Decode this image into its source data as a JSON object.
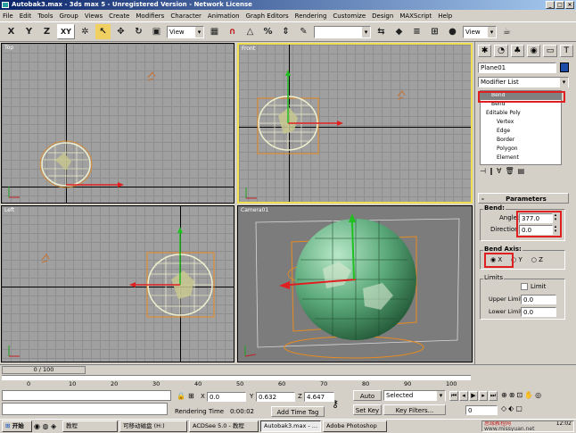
{
  "window": {
    "title": "Autobak3.max - 3ds max 5 - Unregistered Version - Network License"
  },
  "menu": [
    "File",
    "Edit",
    "Tools",
    "Group",
    "Views",
    "Create",
    "Modifiers",
    "Character",
    "Animation",
    "Graph Editors",
    "Rendering",
    "Customize",
    "Design",
    "MAXScript",
    "Help"
  ],
  "toolbar": {
    "axis_x": "X",
    "axis_y": "Y",
    "axis_z": "Z",
    "axis_xy": "XY",
    "view_left": "View",
    "view_right": "View"
  },
  "viewports": {
    "top": "Top",
    "front": "Front",
    "left": "Left",
    "camera": "Camera01"
  },
  "command_panel": {
    "object_name": "Plane01",
    "modifier_list": "Modifier List",
    "stack": [
      "Bend",
      "Bend",
      "Editable Poly",
      "Vertex",
      "Edge",
      "Border",
      "Polygon",
      "Element"
    ],
    "rollout_title": "Parameters",
    "bend_group": "Bend:",
    "angle_label": "Angle:",
    "angle_value": "377.0",
    "direction_label": "Direction:",
    "direction_value": "0.0",
    "bend_axis_group": "Bend Axis:",
    "axis_options": [
      "X",
      "Y",
      "Z"
    ],
    "limits_group": "Limits",
    "limit_checkbox": "Limit",
    "upper_limit_label": "Upper Limit:",
    "upper_limit_value": "0.0",
    "lower_limit_label": "Lower Limit:",
    "lower_limit_value": "0.0"
  },
  "timeline": {
    "frame_display": "0 / 100",
    "ticks": [
      "0",
      "10",
      "20",
      "30",
      "40",
      "50",
      "60",
      "70",
      "80",
      "90",
      "100"
    ]
  },
  "status": {
    "x_label": "X",
    "x_value": "0.0",
    "y_label": "Y",
    "y_value": "0.632",
    "z_label": "Z",
    "z_value": "4.647",
    "rendering_time_label": "Rendering Time",
    "rendering_time_value": "0:00:02",
    "add_time_tag": "Add Time Tag",
    "auto_key": "Auto Key",
    "set_key": "Set Key",
    "selected": "Selected",
    "key_filters": "Key Filters...",
    "frame_field": "0"
  },
  "taskbar": {
    "start": "开始",
    "items": [
      "教程",
      "可移动磁盘 (H:)",
      "ACDSee 5.0 - 教程",
      "Autobak3.max - ...",
      "Adobe Photoshop"
    ],
    "watermark": "思缘教程网",
    "watermark_url": "www.missyuan.net",
    "clock": "12:02"
  },
  "colors": {
    "highlight_red": "#e02020",
    "mesh_green": "#5aa87a",
    "active_viewport": "#f0e050"
  }
}
